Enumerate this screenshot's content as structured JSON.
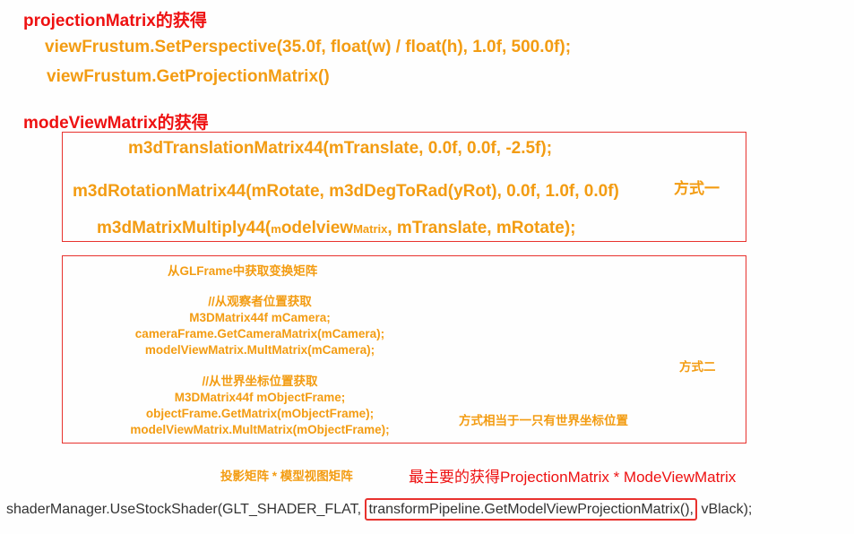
{
  "projection": {
    "heading_main": "projectionMatrix",
    "heading_suffix": "的获得",
    "line1": "viewFrustum.SetPerspective(35.0f, float(w) / float(h), 1.0f, 500.0f);",
    "line2": "viewFrustum.GetProjectionMatrix()"
  },
  "modelview": {
    "heading_main": "modeViewMatrix",
    "heading_suffix": "的获得",
    "method1": {
      "line1": "m3dTranslationMatrix44(mTranslate, 0.0f, 0.0f, -2.5f);",
      "line2": "m3dRotationMatrix44(mRotate, m3dDegToRad(yRot), 0.0f, 1.0f, 0.0f)",
      "line3_prefix": "m3dMatrixMultiply44(",
      "line3_m": "m",
      "line3_odelview": "odelview",
      "line3_matrix": "Matrix",
      "line3_suffix": ", mTranslate, mRotate);",
      "label": "方式一"
    },
    "method2": {
      "title": "从GLFrame中获取变换矩阵",
      "camera_comment": "//从观察者位置获取",
      "camera_line1": "M3DMatrix44f mCamera;",
      "camera_line2": "cameraFrame.GetCameraMatrix(mCamera);",
      "camera_line3": "modelViewMatrix.MultMatrix(mCamera);",
      "world_comment": "//从世界坐标位置获取",
      "world_line1": "M3DMatrix44f mObjectFrame;",
      "world_line2": "objectFrame.GetMatrix(mObjectFrame);",
      "world_line3": "modelViewMatrix.MultMatrix(mObjectFrame);",
      "label": "方式二",
      "note": "方式相当于一只有世界坐标位置"
    }
  },
  "summary": {
    "left": "投影矩阵 * 模型视图矩阵",
    "right": "最主要的获得ProjectionMatrix * ModeViewMatrix"
  },
  "bottom": {
    "prefix": "shaderManager.UseStockShader(GLT_SHADER_FLAT,",
    "highlight": "transformPipeline.GetModelViewProjectionMatrix(),",
    "suffix": "vBlack);"
  },
  "colors": {
    "red": "#ee1111",
    "orange": "#f39c12",
    "box_border": "#e8322e",
    "code_gray": "#333333"
  }
}
